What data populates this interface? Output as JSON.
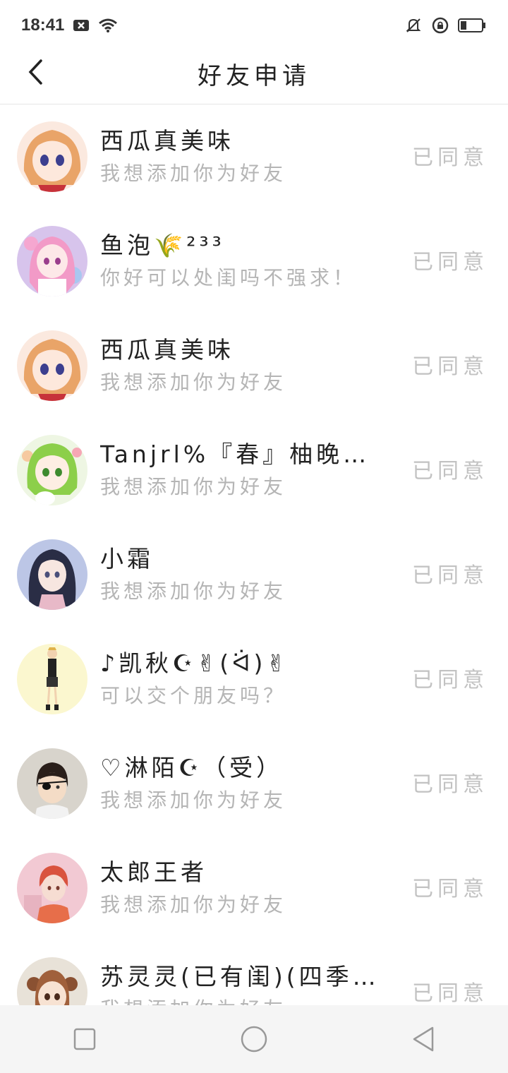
{
  "status_bar": {
    "time": "18:41",
    "icons": [
      "x-notification-icon",
      "wifi-icon",
      "silent-bell-icon",
      "lock-rotation-icon",
      "battery-icon"
    ]
  },
  "header": {
    "title": "好友申请",
    "back_icon": "chevron-left-icon"
  },
  "requests": [
    {
      "name": "西瓜真美味",
      "message": "我想添加你为好友",
      "status": "已同意",
      "avatar": "avatar-orange-hair-girl"
    },
    {
      "name": "鱼泡🌾²³³",
      "message": "你好可以处闺吗不强求！",
      "status": "已同意",
      "avatar": "avatar-pink-hair-girl"
    },
    {
      "name": "西瓜真美味",
      "message": "我想添加你为好友",
      "status": "已同意",
      "avatar": "avatar-orange-hair-girl"
    },
    {
      "name": "Tanjrl%『春』柚晚要…",
      "message": "我想添加你为好友",
      "status": "已同意",
      "avatar": "avatar-green-hair-girl"
    },
    {
      "name": "小霜",
      "message": "我想添加你为好友",
      "status": "已同意",
      "avatar": "avatar-dark-hair-girl"
    },
    {
      "name": "♪凯秋☪✌(ᐛ)✌",
      "message": "可以交个朋友吗？",
      "status": "已同意",
      "avatar": "avatar-standing-figure"
    },
    {
      "name": "♡淋陌☪（受）",
      "message": "我想添加你为好友",
      "status": "已同意",
      "avatar": "avatar-eyepatch-boy"
    },
    {
      "name": "太郎王者",
      "message": "我想添加你为好友",
      "status": "已同意",
      "avatar": "avatar-red-hair-boy"
    },
    {
      "name": "苏灵灵(已有闺)(四季…",
      "message": "我想添加你为好友",
      "status": "已同意",
      "avatar": "avatar-brown-hair-girl"
    }
  ],
  "nav_bar": {
    "icons": [
      "recents-square-icon",
      "home-circle-icon",
      "back-triangle-icon"
    ]
  },
  "colors": {
    "message_gray": "#b5b5b5",
    "status_gray": "#c2c2c2",
    "divider": "#e6e6e6",
    "navbar_bg": "#f5f5f5"
  }
}
